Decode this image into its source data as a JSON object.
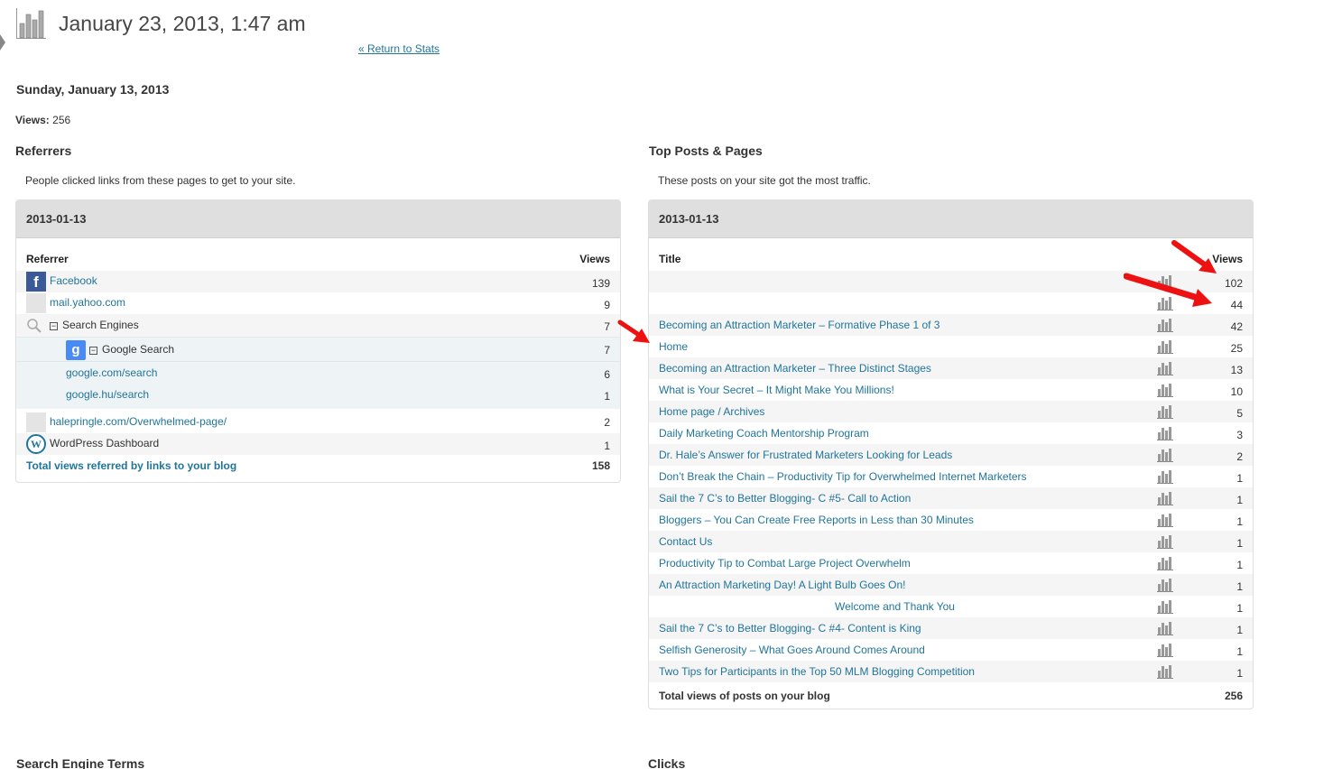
{
  "header": {
    "title": "January 23, 2013, 1:47 am",
    "return_link": "« Return to Stats"
  },
  "day": {
    "title": "Sunday, January 13, 2013",
    "views_label": "Views:",
    "views_value": "256"
  },
  "referrers": {
    "title": "Referrers",
    "description": "People clicked links from these pages to get to your site.",
    "box_date": "2013-01-13",
    "col_label": "Referrer",
    "col_views": "Views",
    "rows": [
      {
        "label": "Facebook",
        "count": "139"
      },
      {
        "label": "mail.yahoo.com",
        "count": "9"
      },
      {
        "label": "Search Engines",
        "count": "7"
      },
      {
        "label": "Google Search",
        "count": "7"
      },
      {
        "label": "google.com/search",
        "count": "6"
      },
      {
        "label": "google.hu/search",
        "count": "1"
      },
      {
        "label": "halepringle.com/Overwhelmed-page/",
        "count": "2"
      },
      {
        "label": "WordPress Dashboard",
        "count": "1"
      }
    ],
    "total_label": "Total views referred by links to your blog",
    "total_value": "158"
  },
  "top_posts": {
    "title": "Top Posts & Pages",
    "description": "These posts on your site got the most traffic.",
    "box_date": "2013-01-13",
    "col_label": "Title",
    "col_views": "Views",
    "rows": [
      {
        "label": "",
        "count": "102"
      },
      {
        "label": "",
        "count": "44"
      },
      {
        "label": "Becoming an Attraction Marketer – Formative Phase 1 of 3",
        "count": "42"
      },
      {
        "label": "Home",
        "count": "25"
      },
      {
        "label": "Becoming an Attraction Marketer – Three Distinct Stages",
        "count": "13"
      },
      {
        "label": "What is Your Secret – It Might Make You Millions!",
        "count": "10"
      },
      {
        "label": "Home page / Archives",
        "count": "5"
      },
      {
        "label": "Daily Marketing Coach Mentorship Program",
        "count": "3"
      },
      {
        "label": "Dr. Hale’s Answer for Frustrated Marketers Looking for Leads",
        "count": "2"
      },
      {
        "label": "Don’t Break the Chain – Productivity Tip for Overwhelmed Internet Marketers",
        "count": "1"
      },
      {
        "label": "Sail the 7 C’s to Better Blogging- C #5- Call to Action",
        "count": "1"
      },
      {
        "label": "Bloggers – You Can Create Free Reports in Less than 30 Minutes",
        "count": "1"
      },
      {
        "label": "Contact Us",
        "count": "1"
      },
      {
        "label": "Productivity Tip to Combat Large Project Overwhelm",
        "count": "1"
      },
      {
        "label": "An Attraction Marketing Day! A Light Bulb Goes On!",
        "count": "1"
      },
      {
        "label": "Welcome and Thank You",
        "count": "1"
      },
      {
        "label": "Sail the 7 C’s to Better Blogging- C #4- Content is King",
        "count": "1"
      },
      {
        "label": "Selfish Generosity – What Goes Around Comes Around",
        "count": "1"
      },
      {
        "label": "Two Tips for Participants in the Top 50 MLM Blogging Competition",
        "count": "1"
      }
    ],
    "total_label": "Total views of posts on your blog",
    "total_value": "256"
  },
  "bottom": {
    "search_terms_title": "Search Engine Terms",
    "clicks_title": "Clicks"
  },
  "icons": {
    "page": "stats-chart-icon",
    "facebook": "facebook-icon",
    "google": "google-icon",
    "wordpress": "wordpress-icon",
    "search": "magnifier-icon",
    "row_bars": "bar-chart-icon",
    "annotation": "red-arrow-icon"
  },
  "colors": {
    "link": "#21759b",
    "header_bg": "#dfdfdf",
    "annotation": "#ee1111"
  }
}
